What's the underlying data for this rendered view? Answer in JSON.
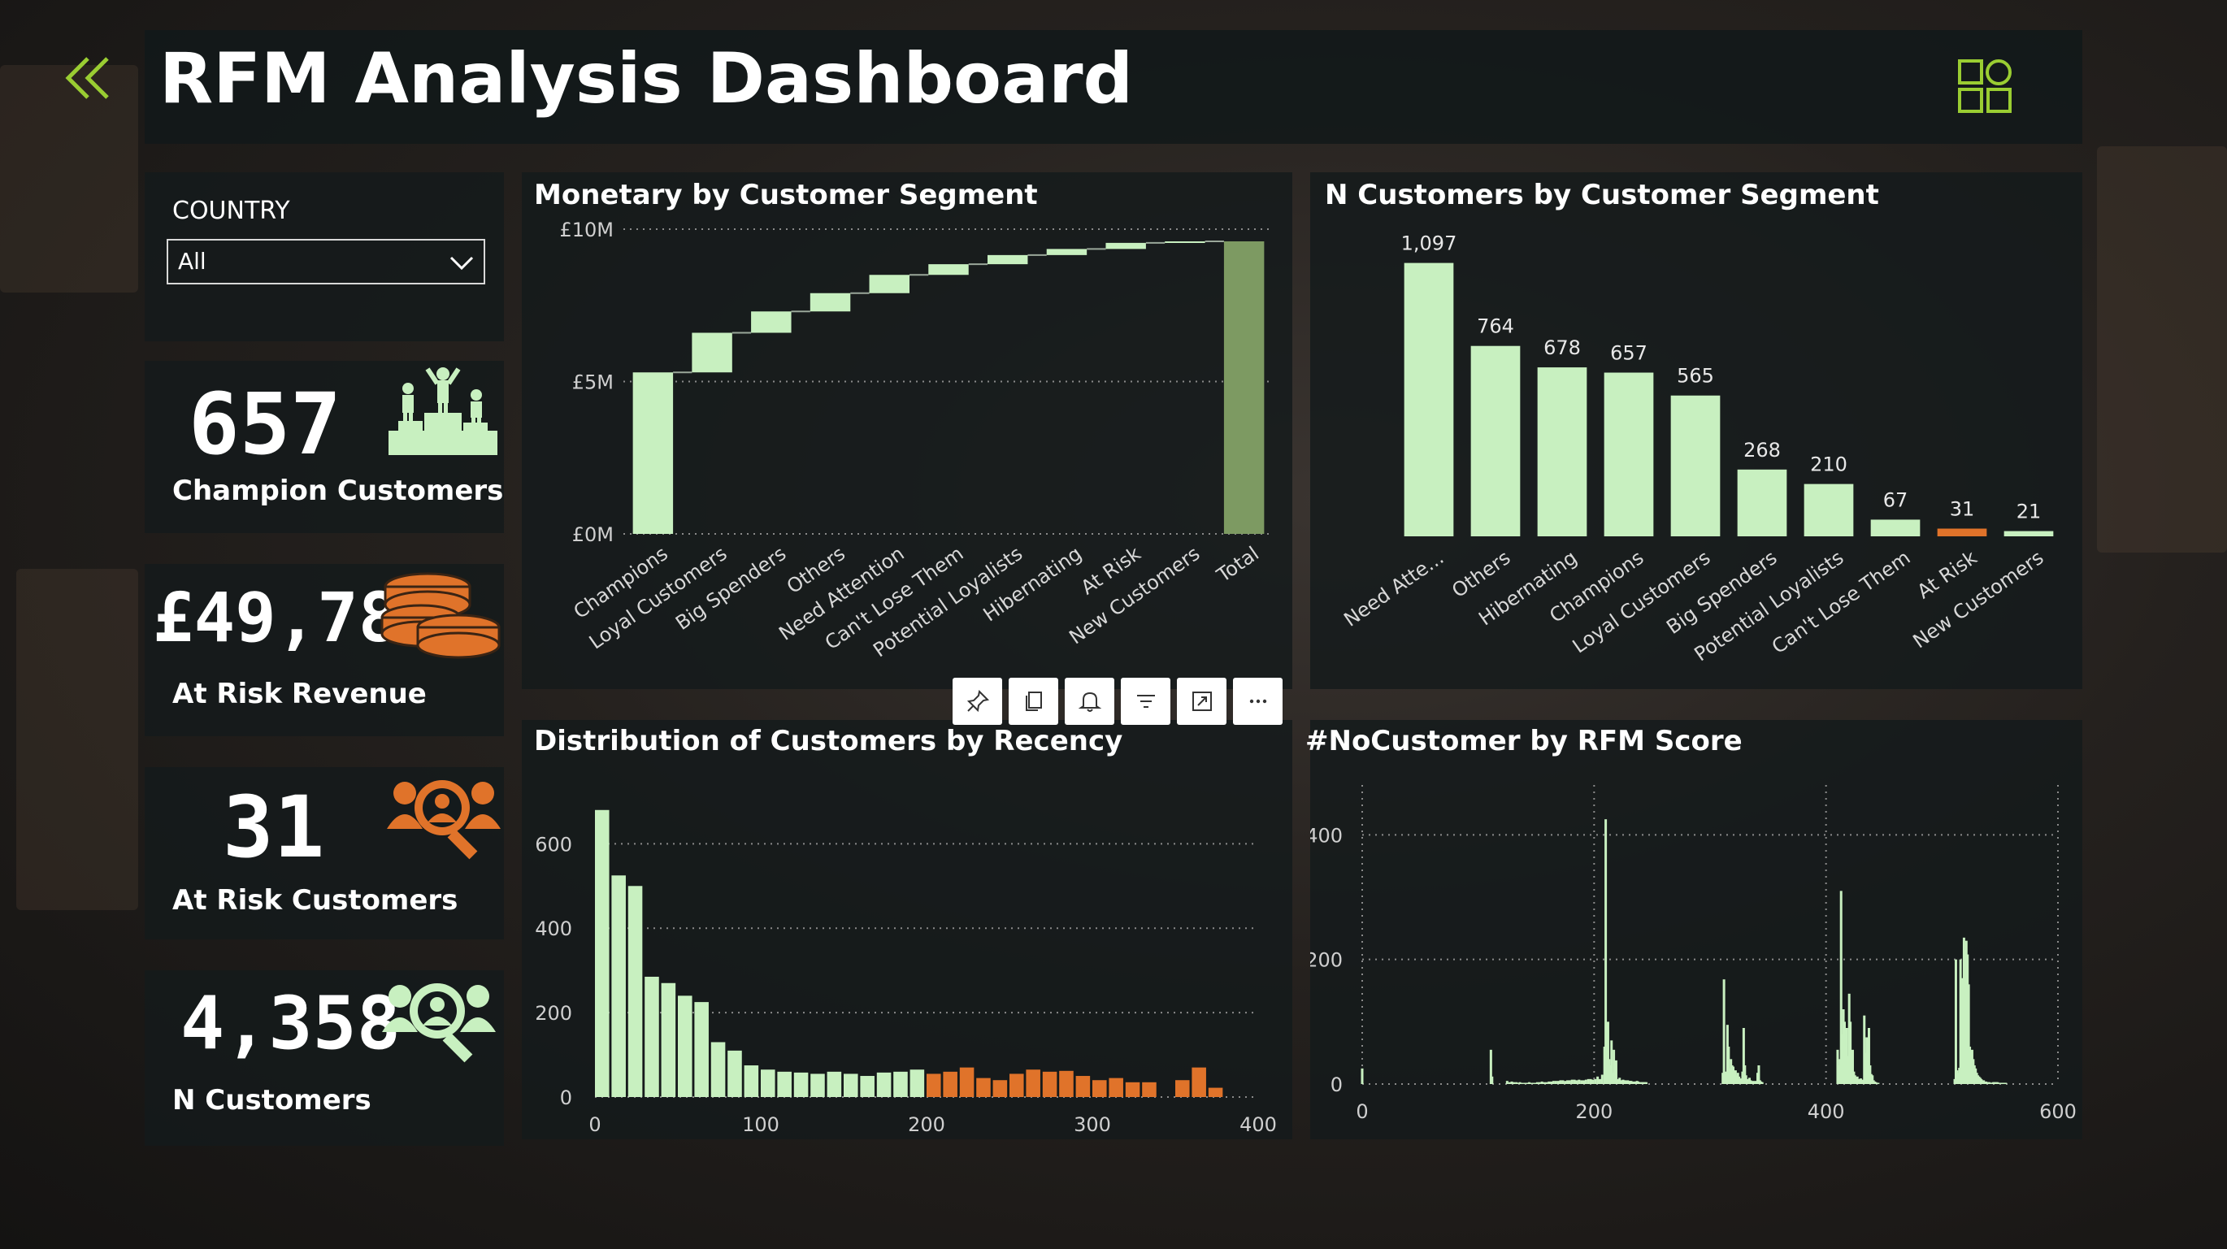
{
  "header": {
    "title": "RFM Analysis Dashboard",
    "back_icon": "double-chevron-left-icon",
    "layout_icon": "grid-layout-icon"
  },
  "filter": {
    "label": "COUNTRY",
    "value": "All"
  },
  "kpis": [
    {
      "value": "657",
      "label": "Champion Customers",
      "icon": "podium-icon",
      "icon_color": "#c8f0c0"
    },
    {
      "value": "£49,785",
      "label": "At Risk Revenue",
      "icon": "coins-icon",
      "icon_color": "#e0732a"
    },
    {
      "value": "31",
      "label": "At Risk Customers",
      "icon": "user-search-icon",
      "icon_color": "#e0732a"
    },
    {
      "value": "4,358",
      "label": "N Customers",
      "icon": "user-search-icon",
      "icon_color": "#c8f0c0"
    }
  ],
  "toolbar": [
    "pin-icon",
    "copy-icon",
    "bell-icon",
    "filter-icon",
    "focus-mode-icon",
    "more-options-icon"
  ],
  "colors": {
    "accent": "#c8f0c0",
    "risk": "#e0732a",
    "total": "#7d9a62",
    "panel": "#141a1c"
  },
  "chart_data": [
    {
      "type": "bar",
      "title": "Monetary by Customer Segment",
      "categories": [
        "Champions",
        "Loyal Customers",
        "Big Spenders",
        "Others",
        "Need Attention",
        "Can't Lose Them",
        "Potential Loyalists",
        "Hibernating",
        "At Risk",
        "New Customers",
        "Total"
      ],
      "values": [
        5.3,
        1.3,
        0.7,
        0.6,
        0.6,
        0.35,
        0.3,
        0.2,
        0.2,
        0.05,
        9.6
      ],
      "is_total": [
        false,
        false,
        false,
        false,
        false,
        false,
        false,
        false,
        false,
        false,
        true
      ],
      "yticks": [
        "£0M",
        "£5M",
        "£10M"
      ],
      "ylim": [
        0,
        10
      ],
      "grid": true
    },
    {
      "type": "bar",
      "title": "N Customers by Customer Segment",
      "categories": [
        "Need Atte...",
        "Others",
        "Hibernating",
        "Champions",
        "Loyal Customers",
        "Big Spenders",
        "Potential Loyalists",
        "Can't Lose Them",
        "At Risk",
        "New Customers"
      ],
      "values": [
        1097,
        764,
        678,
        657,
        565,
        268,
        210,
        67,
        31,
        21
      ],
      "labels": [
        "1,097",
        "764",
        "678",
        "657",
        "565",
        "268",
        "210",
        "67",
        "31",
        "21"
      ],
      "highlight": [
        false,
        false,
        false,
        false,
        false,
        false,
        false,
        false,
        true,
        false
      ],
      "ylim": [
        0,
        1200
      ]
    },
    {
      "type": "bar",
      "title": "Distribution of Customers by Recency",
      "bin_width": 10,
      "values": [
        680,
        525,
        500,
        285,
        270,
        240,
        225,
        130,
        110,
        75,
        65,
        60,
        58,
        55,
        60,
        55,
        50,
        58,
        60,
        65,
        55,
        60,
        70,
        45,
        40,
        55,
        65,
        60,
        62,
        50,
        40,
        45,
        35,
        35,
        0,
        40,
        70,
        22
      ],
      "highlight_from": 200,
      "xticks": [
        "0",
        "100",
        "200",
        "300",
        "400"
      ],
      "yticks": [
        "0",
        "200",
        "400",
        "600"
      ],
      "xlim": [
        0,
        400
      ],
      "ylim": [
        0,
        720
      ],
      "grid": true
    },
    {
      "type": "bar",
      "title": "#NoCustomer by RFM Score",
      "x": [
        0,
        111,
        112,
        125,
        127,
        129,
        131,
        133,
        134,
        136,
        138,
        140,
        142,
        144,
        145,
        147,
        149,
        151,
        153,
        155,
        157,
        159,
        161,
        163,
        165,
        167,
        169,
        171,
        173,
        175,
        177,
        179,
        181,
        183,
        185,
        187,
        189,
        191,
        193,
        195,
        197,
        199,
        201,
        203,
        205,
        207,
        209,
        210,
        211,
        212,
        213,
        214,
        215,
        216,
        217,
        218,
        219,
        220,
        221,
        222,
        223,
        224,
        225,
        226,
        227,
        228,
        229,
        230,
        231,
        232,
        233,
        234,
        235,
        236,
        237,
        238,
        239,
        240,
        241,
        242,
        243,
        244,
        245,
        311,
        312,
        313,
        314,
        315,
        316,
        317,
        318,
        319,
        320,
        321,
        322,
        323,
        324,
        325,
        326,
        327,
        328,
        329,
        330,
        331,
        332,
        333,
        334,
        335,
        336,
        337,
        338,
        339,
        340,
        341,
        342,
        343,
        344,
        345,
        410,
        411,
        412,
        413,
        414,
        415,
        416,
        417,
        418,
        419,
        420,
        421,
        422,
        423,
        424,
        425,
        426,
        427,
        428,
        429,
        430,
        431,
        432,
        433,
        434,
        435,
        436,
        437,
        438,
        439,
        440,
        441,
        442,
        443,
        444,
        445,
        511,
        512,
        513,
        514,
        515,
        516,
        517,
        518,
        519,
        520,
        521,
        522,
        523,
        524,
        525,
        526,
        527,
        528,
        529,
        530,
        531,
        532,
        533,
        534,
        535,
        536,
        537,
        538,
        539,
        540,
        541,
        542,
        543,
        544,
        545,
        546,
        547,
        548,
        549,
        550,
        551,
        552,
        553,
        554,
        555
      ],
      "values": [
        25,
        55,
        12,
        5,
        3,
        4,
        3,
        3,
        2,
        3,
        2,
        2,
        2,
        3,
        2,
        2,
        2,
        3,
        3,
        4,
        3,
        3,
        4,
        4,
        5,
        5,
        5,
        6,
        6,
        5,
        6,
        6,
        7,
        7,
        6,
        7,
        6,
        6,
        7,
        8,
        8,
        7,
        8,
        12,
        8,
        15,
        60,
        425,
        50,
        100,
        40,
        30,
        70,
        18,
        55,
        25,
        38,
        6,
        8,
        10,
        6,
        6,
        7,
        6,
        6,
        5,
        6,
        5,
        5,
        5,
        4,
        4,
        4,
        4,
        5,
        4,
        3,
        3,
        3,
        3,
        3,
        3,
        3,
        18,
        168,
        15,
        20,
        95,
        60,
        25,
        40,
        30,
        28,
        10,
        22,
        14,
        18,
        12,
        9,
        8,
        20,
        90,
        30,
        14,
        8,
        6,
        10,
        6,
        4,
        5,
        3,
        5,
        4,
        18,
        30,
        6,
        4,
        3,
        55,
        30,
        40,
        310,
        80,
        120,
        100,
        60,
        90,
        45,
        145,
        100,
        30,
        55,
        20,
        14,
        10,
        12,
        8,
        8,
        9,
        6,
        7,
        110,
        50,
        75,
        40,
        90,
        30,
        16,
        14,
        6,
        4,
        3,
        2,
        2,
        8,
        200,
        22,
        18,
        26,
        200,
        170,
        40,
        235,
        215,
        230,
        208,
        160,
        60,
        50,
        55,
        40,
        30,
        25,
        18,
        14,
        12,
        10,
        8,
        6,
        6,
        4,
        4,
        3,
        3,
        3,
        2,
        2,
        3,
        3,
        3,
        3,
        3,
        2,
        2,
        2,
        2,
        2,
        2,
        2,
        2,
        2
      ],
      "xticks": [
        "0",
        "200",
        "400",
        "600"
      ],
      "yticks": [
        "0",
        "200",
        "400"
      ],
      "xlim": [
        0,
        600
      ],
      "ylim": [
        0,
        480
      ],
      "grid": true
    }
  ]
}
